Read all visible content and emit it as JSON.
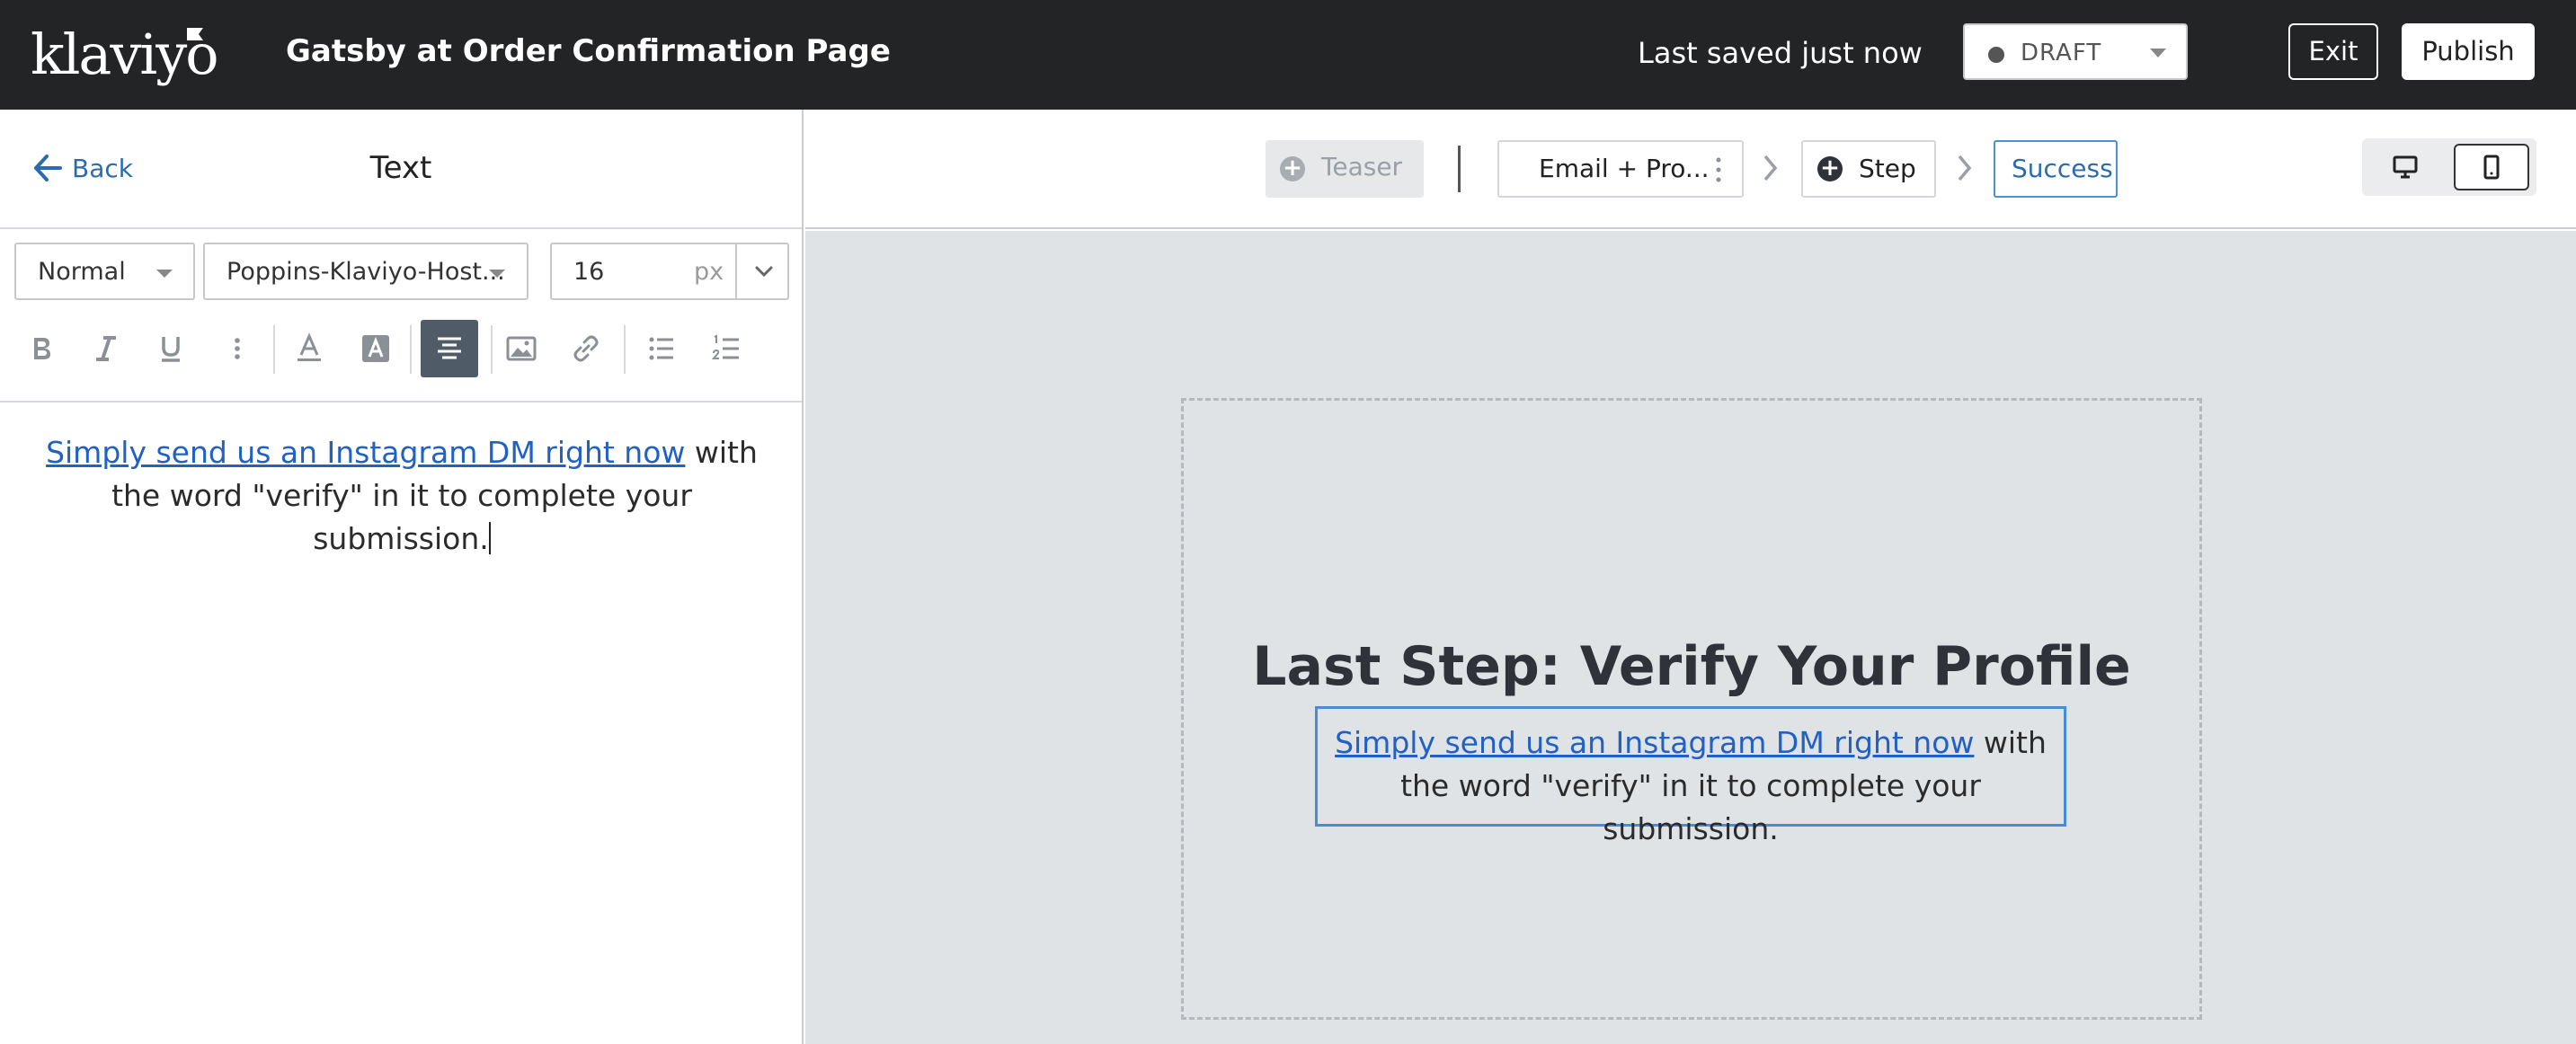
{
  "app": {
    "logo_text": "klaviyo"
  },
  "header": {
    "page_name": "Gatsby at Order Confirmation Page",
    "saved_status": "Last saved just now",
    "status_value": "DRAFT",
    "exit_label": "Exit",
    "publish_label": "Publish"
  },
  "panel": {
    "back_label": "Back",
    "title": "Text",
    "style_select": "Normal",
    "font_select": "Poppins-Klaviyo-Host...",
    "font_size": "16",
    "font_size_unit": "px",
    "toolbar": [
      "bold-icon",
      "italic-icon",
      "underline-icon",
      "more-vertical-icon",
      "text-color-icon",
      "highlight-color-icon",
      "align-center-icon",
      "image-icon",
      "link-icon",
      "bullet-list-icon",
      "numbered-list-icon"
    ],
    "editor": {
      "link_text": "Simply send us an Instagram DM right now",
      "rest_text": " with the word \"verify\" in it to complete your submission."
    }
  },
  "steps": {
    "teaser": "Teaser",
    "email": "Email + Pro...",
    "step": "Step",
    "success": "Success"
  },
  "canvas": {
    "title": "Last Step: Verify Your Profile",
    "link_text": "Simply send us an Instagram DM right now",
    "rest_text": " with the word \"verify\" in it to complete your submission."
  },
  "colors": {
    "topbar": "#232426",
    "link": "#2160c4",
    "accent": "#4a90d9",
    "canvas_bg": "#e0e3e6"
  }
}
